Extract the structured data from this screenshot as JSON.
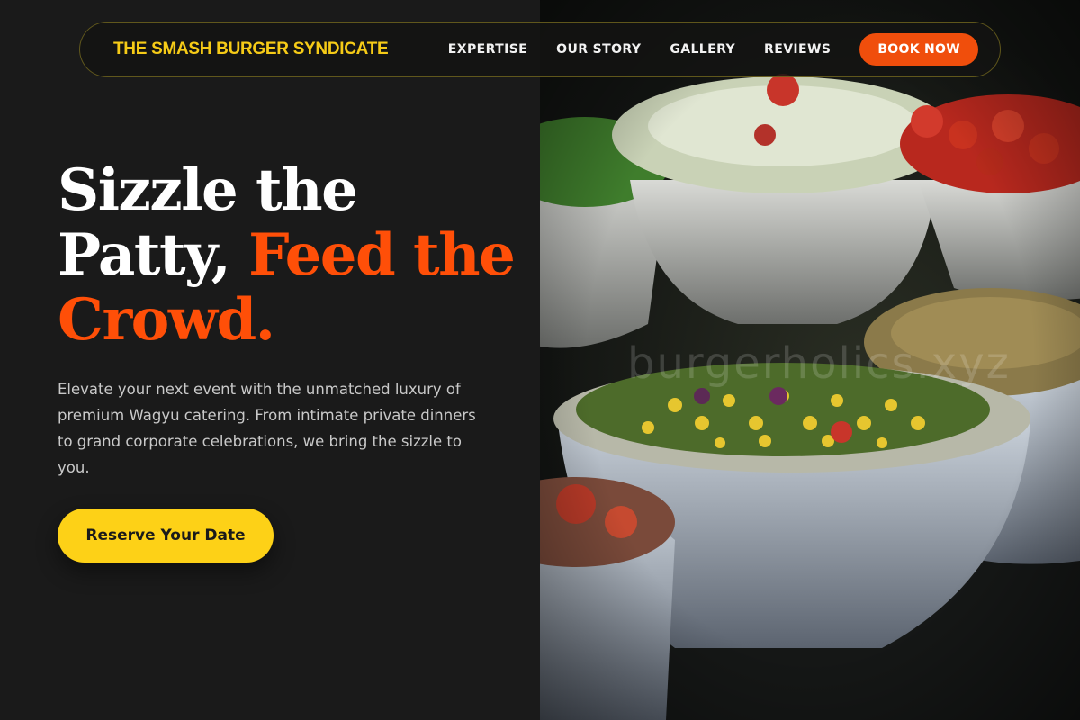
{
  "nav": {
    "brand": "THE SMASH BURGER SYNDICATE",
    "links": [
      "EXPERTISE",
      "OUR STORY",
      "GALLERY",
      "REVIEWS"
    ],
    "cta": "BOOK NOW"
  },
  "hero": {
    "headline_plain": "Sizzle the Patty,",
    "headline_accent": "Feed the Crowd.",
    "body": "Elevate your next event with the unmatched luxury of premium Wagyu catering. From intimate private dinners to grand corporate celebrations, we bring the sizzle to you.",
    "cta": "Reserve Your Date"
  },
  "image": {
    "watermark": "burgerholics.xyz"
  },
  "colors": {
    "background": "#1a1a1a",
    "brand_yellow": "#f6cb17",
    "accent_orange": "#ff4f08",
    "button_orange": "#f04e0c",
    "cta_yellow": "#fdd117"
  }
}
